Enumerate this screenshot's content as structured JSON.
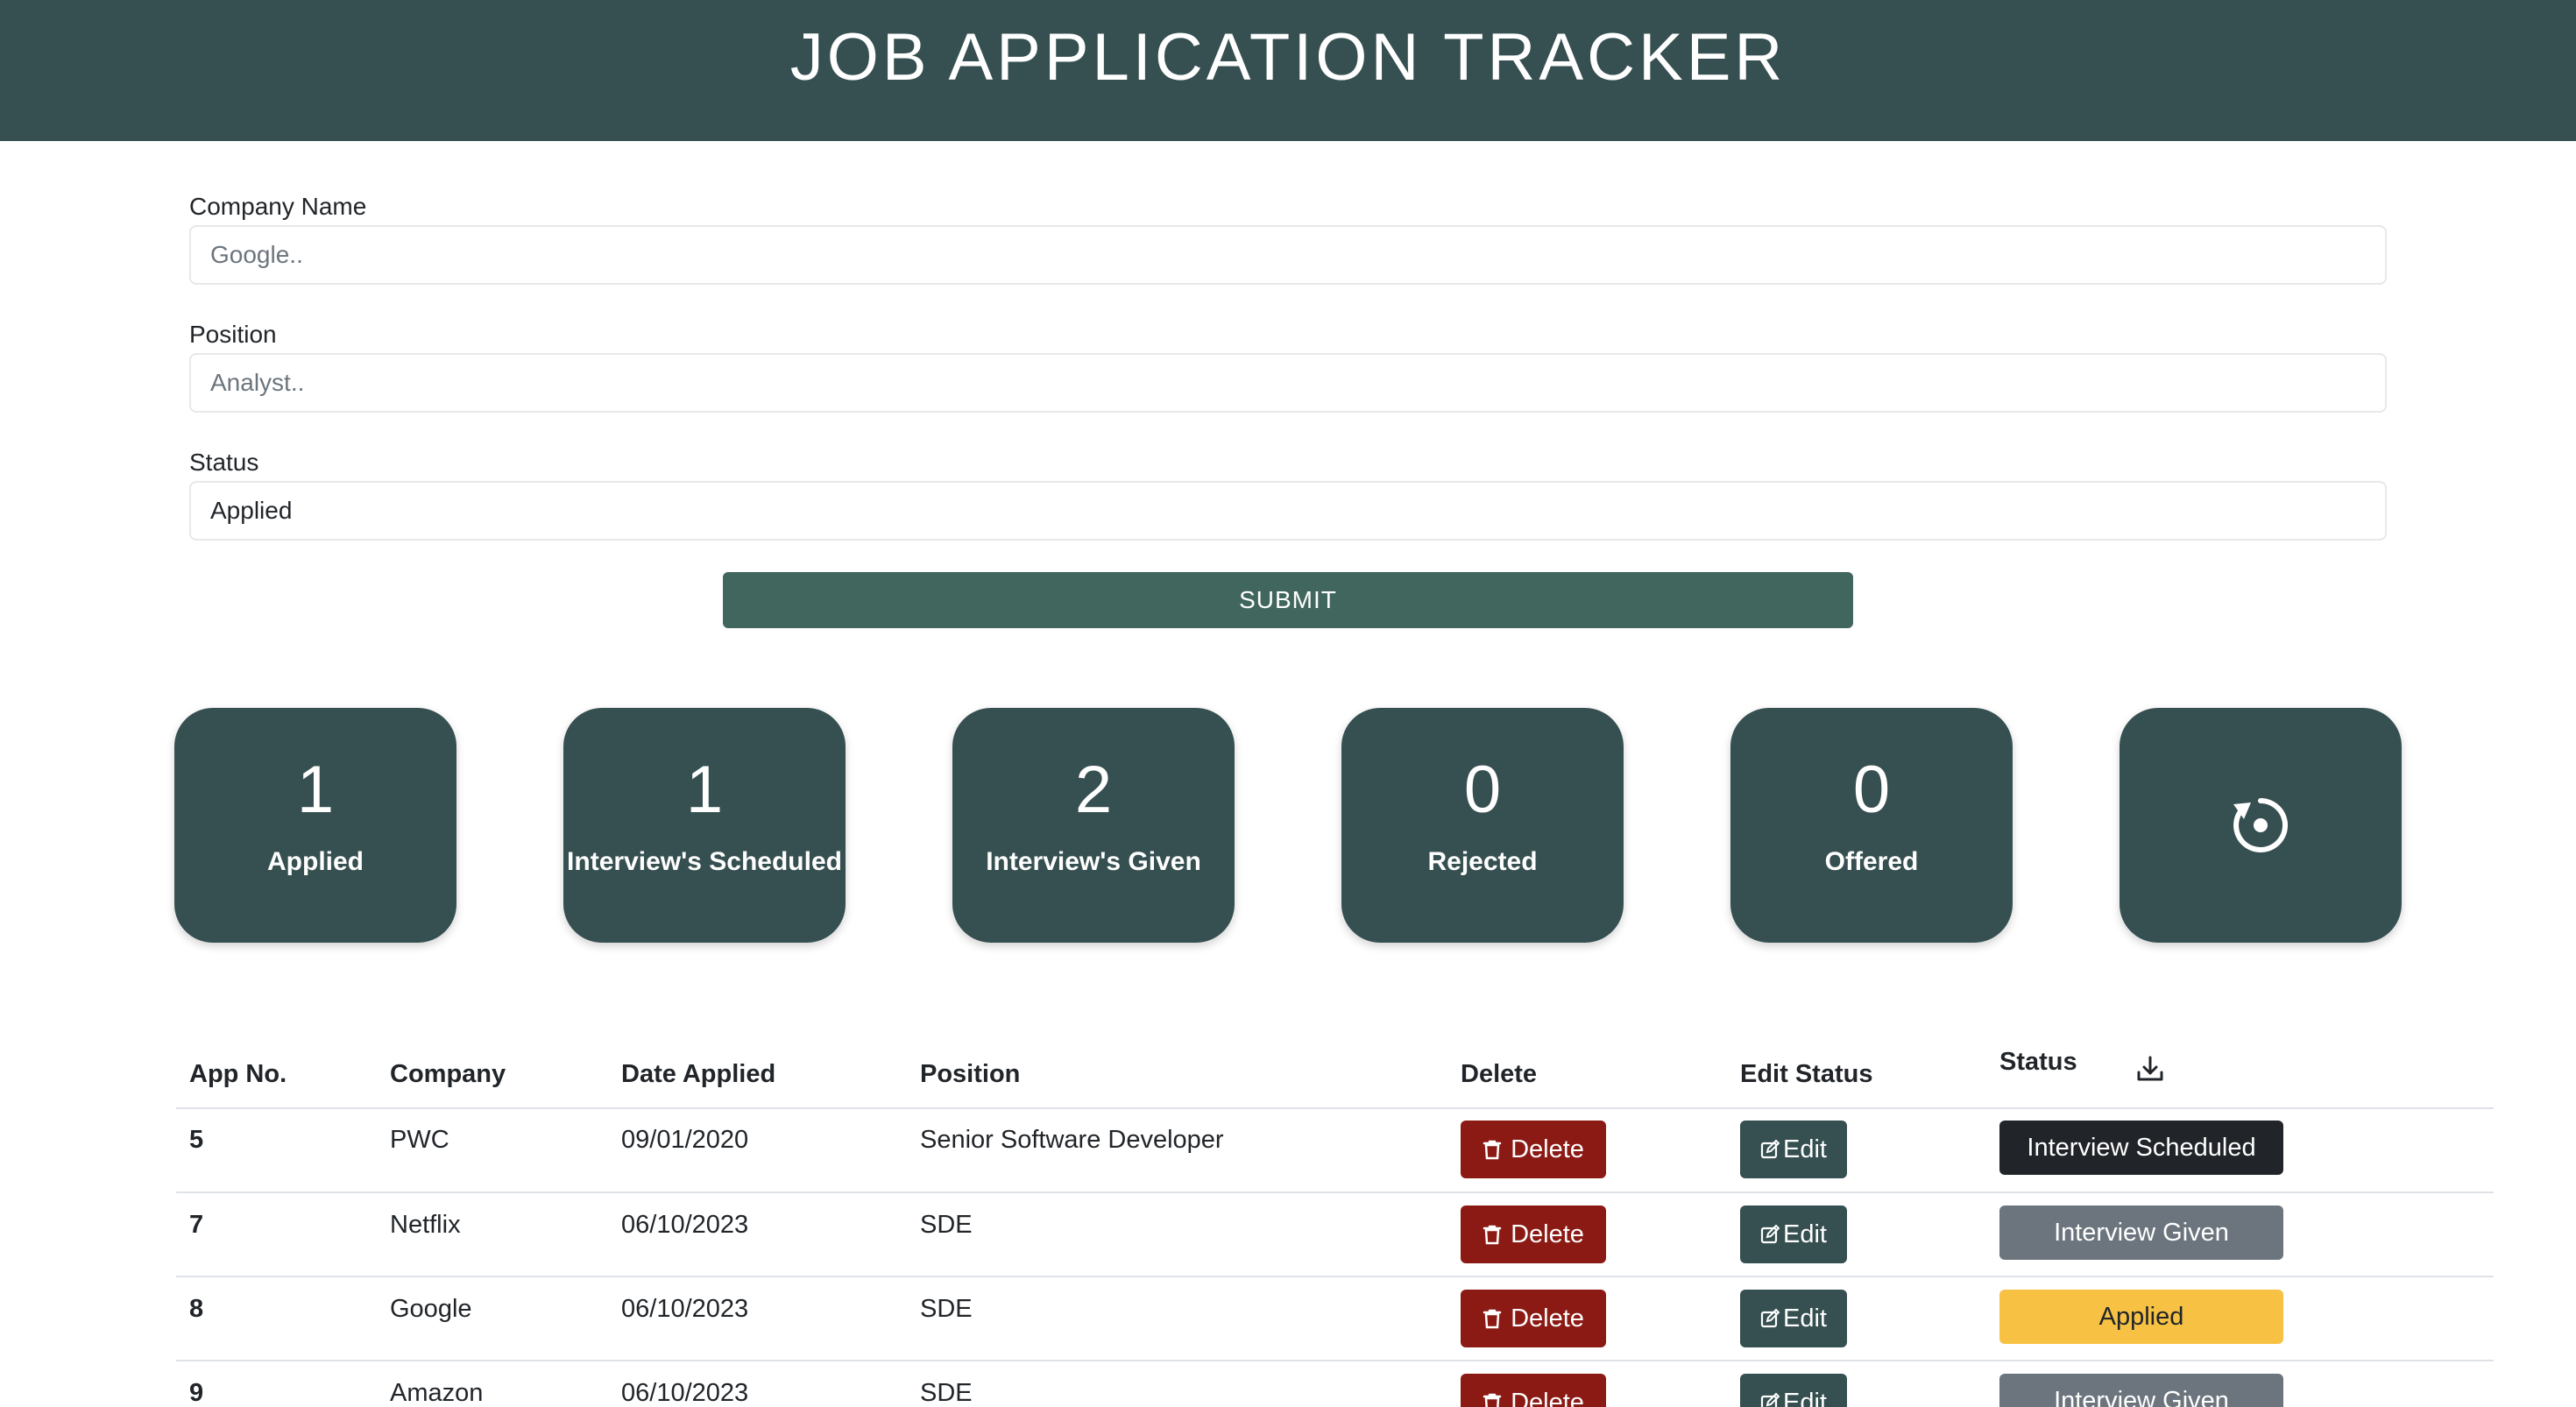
{
  "header": {
    "title": "JOB APPLICATION TRACKER"
  },
  "form": {
    "company": {
      "label": "Company Name",
      "placeholder": "Google.."
    },
    "position": {
      "label": "Position",
      "placeholder": "Analyst.."
    },
    "status": {
      "label": "Status",
      "value": "Applied"
    },
    "submit_label": "SUBMIT"
  },
  "stats": [
    {
      "count": "1",
      "label": "Applied"
    },
    {
      "count": "1",
      "label": "Interview's Scheduled"
    },
    {
      "count": "2",
      "label": "Interview's Given"
    },
    {
      "count": "0",
      "label": "Rejected"
    },
    {
      "count": "0",
      "label": "Offered"
    }
  ],
  "reset": {
    "icon": "reset-icon"
  },
  "table": {
    "headers": {
      "app_no": "App No.",
      "company": "Company",
      "date": "Date Applied",
      "position": "Position",
      "delete": "Delete",
      "edit": "Edit Status",
      "status": "Status"
    },
    "download_icon": "download-icon",
    "delete_label": "Delete",
    "edit_label": "Edit",
    "rows": [
      {
        "app_no": "5",
        "company": "PWC",
        "date": "09/01/2020",
        "position": "Senior Software Developer",
        "status": "Interview Scheduled"
      },
      {
        "app_no": "7",
        "company": "Netflix",
        "date": "06/10/2023",
        "position": "SDE",
        "status": "Interview Given"
      },
      {
        "app_no": "8",
        "company": "Google",
        "date": "06/10/2023",
        "position": "SDE",
        "status": "Applied"
      },
      {
        "app_no": "9",
        "company": "Amazon",
        "date": "06/10/2023",
        "position": "SDE",
        "status": "Interview Given"
      }
    ]
  },
  "colors": {
    "header_bg": "#364f50",
    "submit_bg": "#41665e",
    "delete_bg": "#8b1a14",
    "status_interview_scheduled": "#212529",
    "status_interview_given": "#6c757d",
    "status_applied": "#f7c244"
  }
}
